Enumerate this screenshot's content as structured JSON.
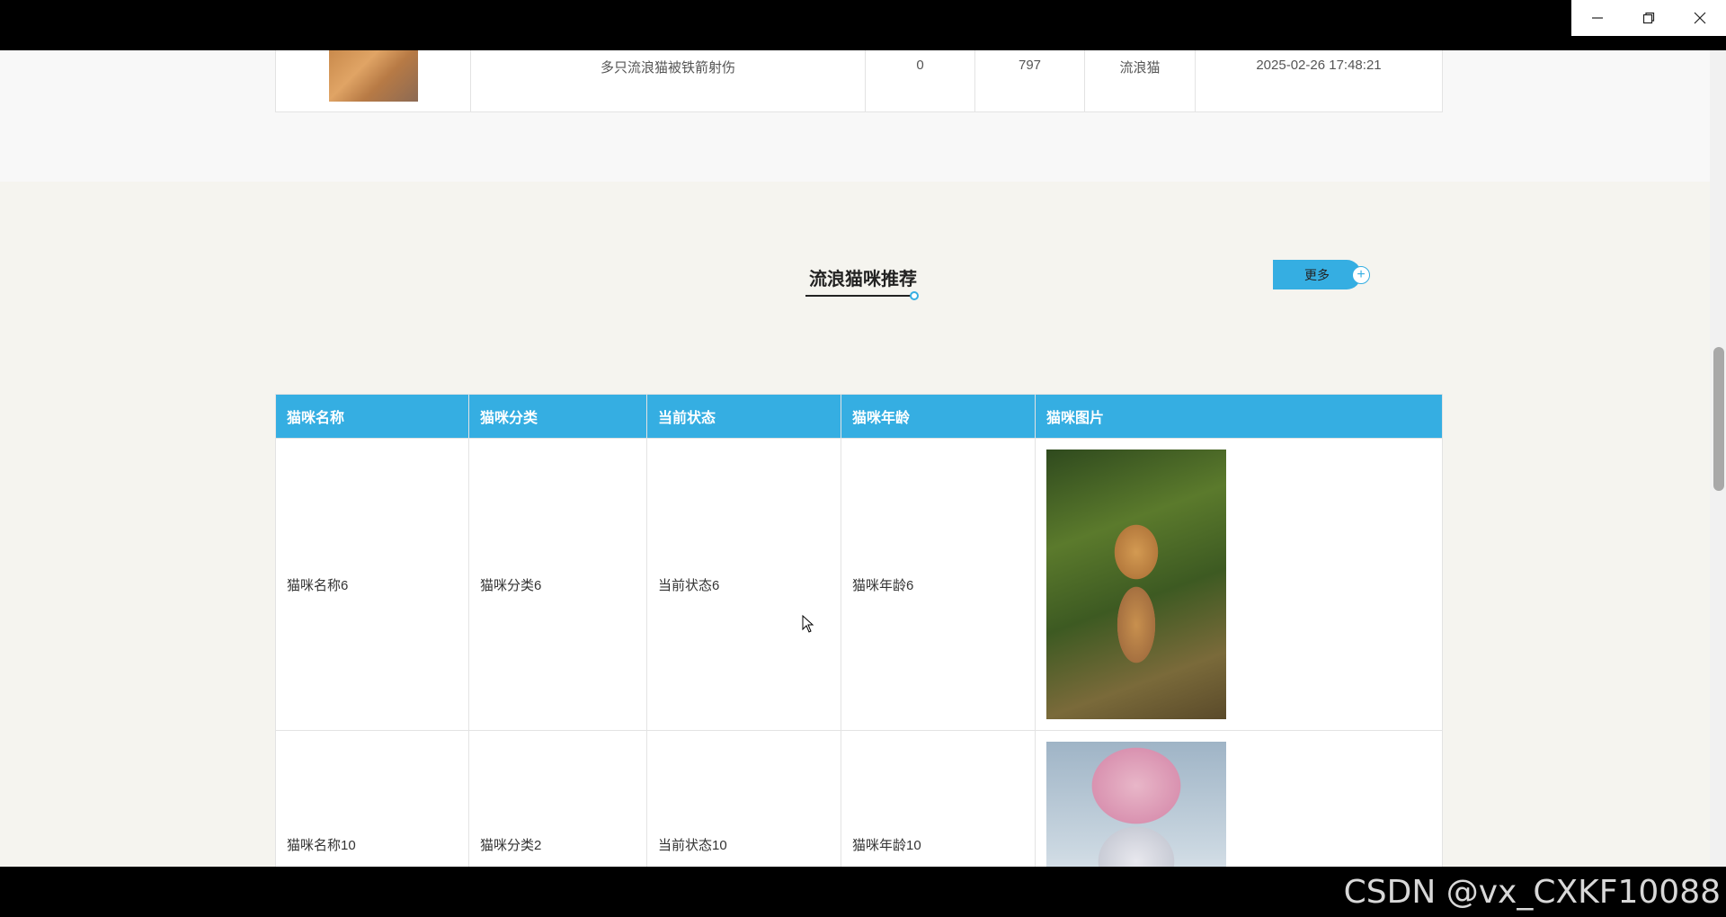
{
  "window": {
    "controls": [
      "minimize",
      "restore",
      "close"
    ]
  },
  "news": {
    "row": {
      "title": "多只流浪猫被铁箭射伤",
      "col2": "0",
      "col3": "797",
      "category": "流浪猫",
      "time": "2025-02-26 17:48:21"
    }
  },
  "recommend": {
    "title": "流浪猫咪推荐",
    "more_label": "更多",
    "more_icon": "plus-circle-icon",
    "columns": [
      "猫咪名称",
      "猫咪分类",
      "当前状态",
      "猫咪年龄",
      "猫咪图片"
    ],
    "rows": [
      {
        "name": "猫咪名称6",
        "category": "猫咪分类6",
        "status": "当前状态6",
        "age": "猫咪年龄6",
        "image": "orange-tabby-kitten-in-plants"
      },
      {
        "name": "猫咪名称10",
        "category": "猫咪分类2",
        "status": "当前状态10",
        "age": "猫咪年龄10",
        "image": "kitten-in-pink-knit-hat"
      }
    ]
  },
  "accent_color": "#35aee2",
  "watermark": "CSDN @vx_CXKF10088"
}
